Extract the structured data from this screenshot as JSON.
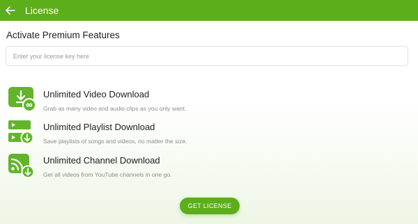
{
  "header": {
    "back_icon": "arrow-left-icon",
    "title": "License"
  },
  "activation": {
    "title": "Activate Premium Features",
    "license_input": {
      "value": "",
      "placeholder": "Enter your license key here"
    }
  },
  "features": [
    {
      "icon": "video-download-infinity-icon",
      "title": "Unlimited Video Download",
      "description": "Grab as many video and audio clips as you only want."
    },
    {
      "icon": "playlist-download-icon",
      "title": "Unlimited Playlist Download",
      "description": "Save playlists of songs and videos, no matter the size."
    },
    {
      "icon": "channel-download-icon",
      "title": "Unlimited Channel Download",
      "description": "Get all videos from YouTube channels in one go."
    }
  ],
  "cta": {
    "label": "GET LICENSE"
  },
  "colors": {
    "accent": "#5cae1b",
    "icon_green": "#62b52a",
    "text_primary": "#1d1d1d",
    "text_secondary": "#8b8b8b"
  }
}
